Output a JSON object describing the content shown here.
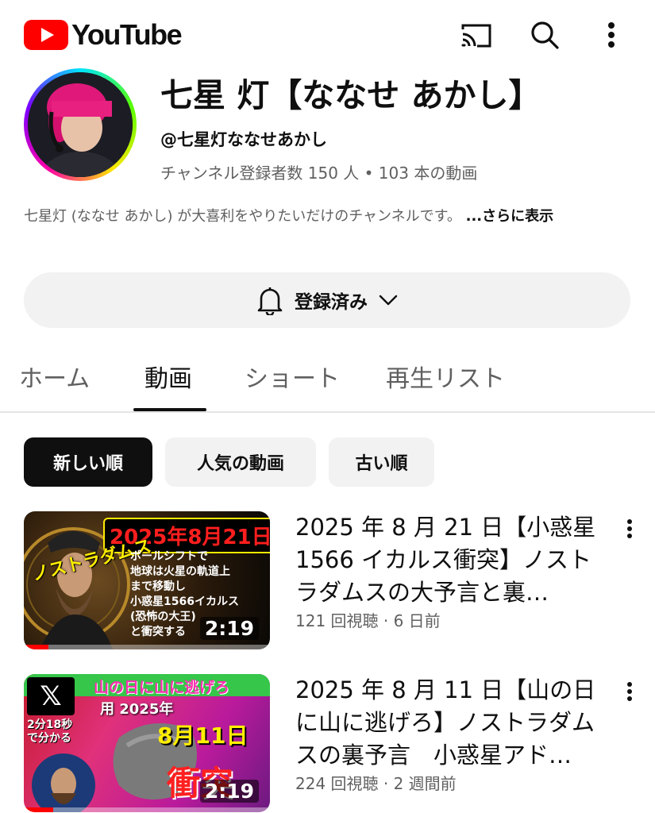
{
  "app": {
    "logo_text": "YouTube",
    "brand_color": "#FF0000"
  },
  "header_icons": [
    "cast-icon",
    "search-icon",
    "more-vert-icon"
  ],
  "channel": {
    "name": "七星 灯【ななせ あかし】",
    "handle": "@七星灯ななせあかし",
    "stats": "チャンネル登録者数 150 人 • 103 本の動画",
    "description": "七星灯 (ななせ あかし) が大喜利をやりたいだけのチャンネルです。",
    "more_label": "...さらに表示"
  },
  "subscribe": {
    "label": "登録済み"
  },
  "tabs": [
    {
      "label": "ホーム"
    },
    {
      "label": "動画"
    },
    {
      "label": "ショート"
    },
    {
      "label": "再生リスト"
    }
  ],
  "active_tab": "動画",
  "chips": [
    {
      "label": "新しい順"
    },
    {
      "label": "人気の動画"
    },
    {
      "label": "古い順"
    }
  ],
  "active_chip": "新しい順",
  "videos": [
    {
      "title": "2025 年 8 月 21 日【小惑星 1566 イカルス衝突】ノストラダムスの大予言と裏…",
      "meta": "121 回視聴 · 6 日前",
      "duration": "2:19",
      "watch_progress": 0.1,
      "thumb": {
        "date": "2025年8月21日",
        "side_text": "ノストラダムス",
        "lines": [
          "ポールシフトで",
          "地球は火星の軌道上",
          "まで移動し",
          "小惑星1566イカルス",
          "(恐怖の大王)",
          "と衝突する"
        ]
      }
    },
    {
      "title": "2025 年 8 月 11 日【山の日に山に逃げろ】ノストラダムスの裏予言　小惑星アド…",
      "meta": "224 回視聴 · 2 週間前",
      "duration": "2:19",
      "watch_progress": 0.12,
      "thumb": {
        "x_logo": "𝕏",
        "banner": "山の日に山に逃げろ",
        "year": "用 2025年",
        "date": "8月11日",
        "small": [
          "2分18秒",
          "で分かる"
        ],
        "impact": "衝突"
      }
    }
  ]
}
